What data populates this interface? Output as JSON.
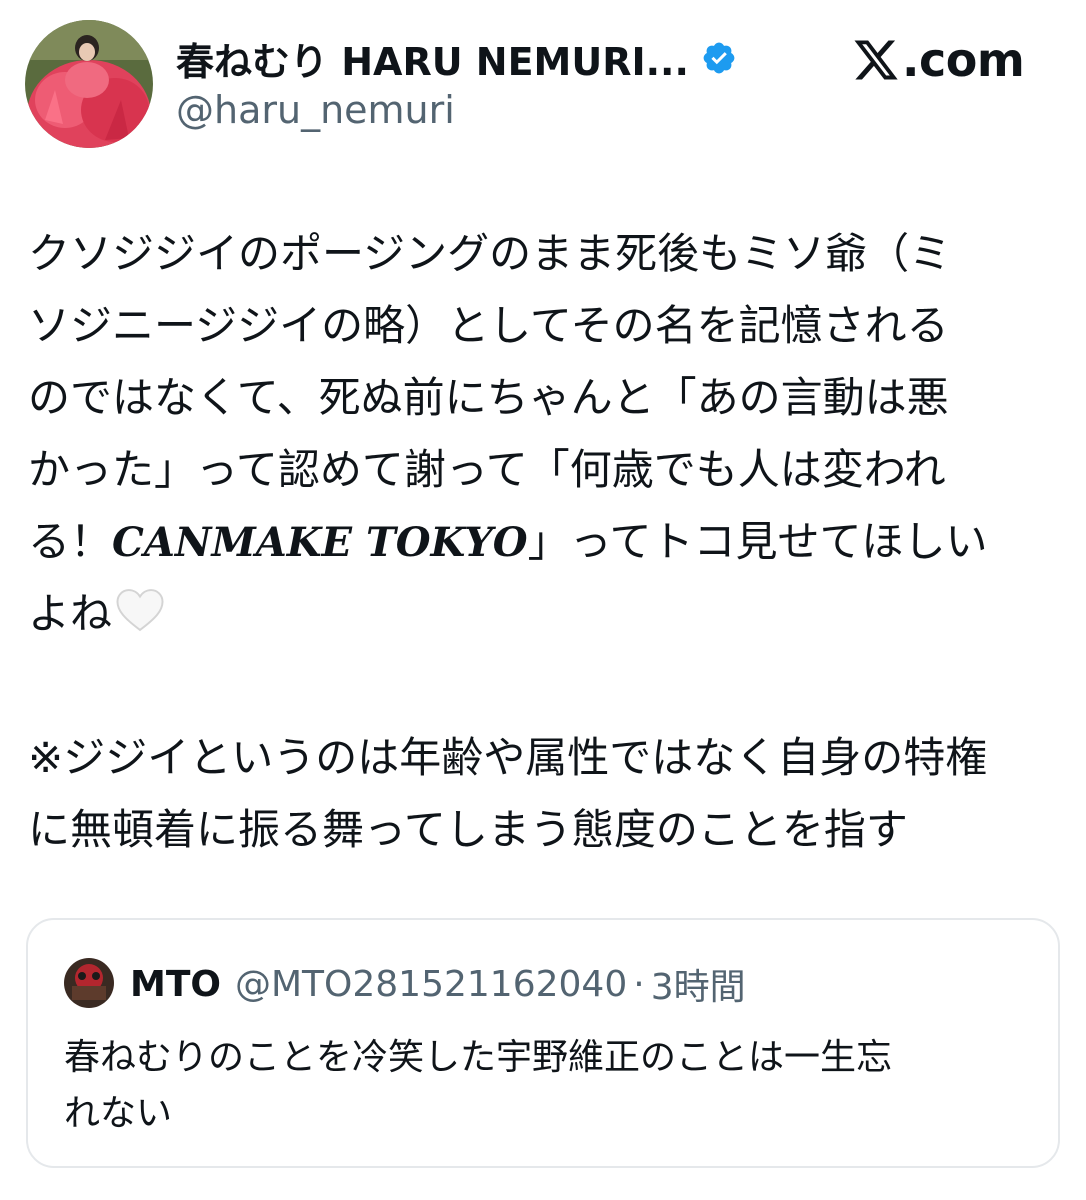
{
  "author": {
    "display_name": "春ねむり HARU NEMURI...",
    "handle": "@haru_nemuri",
    "verified": true
  },
  "brand": {
    "site_label": ".com",
    "logo_icon": "x-logo-icon"
  },
  "tweet": {
    "line1": "クソジジイのポージングのまま死後もミソ爺（ミ",
    "line2": "ソジニージジイの略）としてその名を記憶される",
    "line3": "のではなくて、死ぬ前にちゃんと「あの言動は悪",
    "line4": "かった」って認めて謝って「何歳でも人は変われ",
    "line5_before": "る！",
    "line5_brand": "CANMAKE TOKYO",
    "line5_after": "」ってトコ見せてほしい",
    "line6": "よね",
    "line6_emoji_icon": "white-heart-icon",
    "note_line1": "※ジジイというのは年齢や属性ではなく自身の特権",
    "note_line2": "に無頓着に振る舞ってしまう態度のことを指す"
  },
  "quote": {
    "name": "MTO",
    "handle": "@MTO281521162040",
    "separator": "·",
    "time": "3時間",
    "text_line1": "春ねむりのことを冷笑した宇野維正のことは一生忘",
    "text_line2": "れない"
  },
  "colors": {
    "text_primary": "#0f1419",
    "text_secondary": "#536471",
    "verified_blue": "#1d9bf0",
    "card_border": "#e5e8eb"
  }
}
